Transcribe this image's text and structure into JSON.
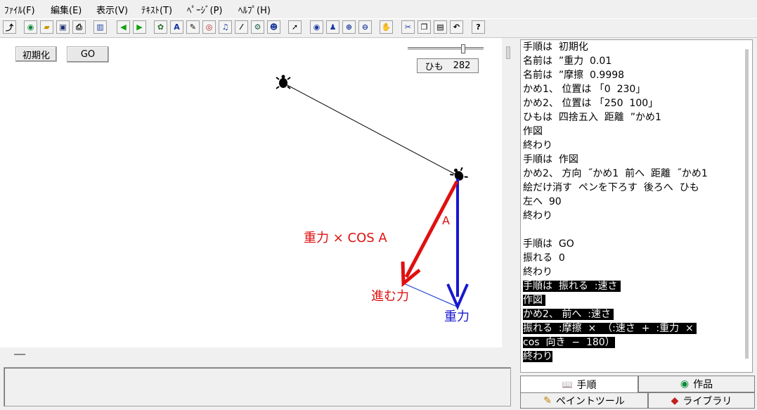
{
  "menu": [
    "ﾌｧｲﾙ(F)",
    "編集(E)",
    "表示(V)",
    "ﾃｷｽﾄ(T)",
    "ﾍﾟｰｼﾞ(P)",
    "ﾍﾙﾌﾟ(H)"
  ],
  "toolbar_icons": [
    "back-icon",
    "globe-icon",
    "open-folder-icon",
    "save-icon",
    "print-icon",
    "book-icon",
    "arrow-left-icon",
    "arrow-right-icon",
    "turtle-icon",
    "text-tool-icon",
    "pen-tool-icon",
    "eye-tool-icon",
    "music-icon",
    "brush-icon",
    "camera-icon",
    "robot-icon",
    "pointer-icon",
    "view-icon",
    "stamp-icon",
    "zoom-in-icon",
    "zoom-out-icon",
    "stop-icon",
    "cut-icon",
    "copy-icon",
    "paste-icon",
    "undo-icon",
    "help-icon"
  ],
  "canvas": {
    "init_button": "初期化",
    "go_button": "GO",
    "string_label": "ひも",
    "string_value": "282",
    "slider_level": 0.73,
    "label_gravity_cos": "重力  ×  COS A",
    "label_angle": "A",
    "label_advance": "進む力",
    "label_gravity": "重力"
  },
  "code_lines": [
    {
      "t": "手順は  初期化",
      "hl": false
    },
    {
      "t": "名前は  ”重力  0.01",
      "hl": false
    },
    {
      "t": "名前は  ”摩擦  0.9998",
      "hl": false
    },
    {
      "t": "かめ1、 位置は 「0  230」",
      "hl": false
    },
    {
      "t": "かめ2、 位置は 「250  100」",
      "hl": false
    },
    {
      "t": "ひもは  四捨五入  距離  ”かめ1",
      "hl": false
    },
    {
      "t": "作図",
      "hl": false
    },
    {
      "t": "終わり",
      "hl": false
    },
    {
      "t": "手順は  作図",
      "hl": false
    },
    {
      "t": "かめ2、 方向  ˝かめ1  前へ  距離  ˝かめ1",
      "hl": false
    },
    {
      "t": "絵だけ消す  ペンを下ろす  後ろへ  ひも",
      "hl": false
    },
    {
      "t": "左へ  90",
      "hl": false
    },
    {
      "t": "終わり",
      "hl": false
    },
    {
      "t": "",
      "hl": false
    },
    {
      "t": "手順は  GO",
      "hl": false
    },
    {
      "t": "振れる  0",
      "hl": false
    },
    {
      "t": "終わり",
      "hl": false
    },
    {
      "t": "手順は  振れる  :速さ ",
      "hl": true
    },
    {
      "t": "作図 ",
      "hl": true
    },
    {
      "t": "かめ2、 前へ  :速さ ",
      "hl": true
    },
    {
      "t": "振れる  :摩擦  ×  （:速さ  +  :重力  × ",
      "hl": true
    },
    {
      "t": "cos  向き  −  180）",
      "hl": true
    },
    {
      "t": "終わり",
      "hl": true
    }
  ],
  "tabs": {
    "procedure": "手順",
    "works": "作品",
    "paint_tool": "ペイントツール",
    "library": "ライブラリ"
  },
  "colors": {
    "red_vector": "#e01010",
    "blue_vector": "#1818d0",
    "thin_blue": "#2040d0"
  }
}
